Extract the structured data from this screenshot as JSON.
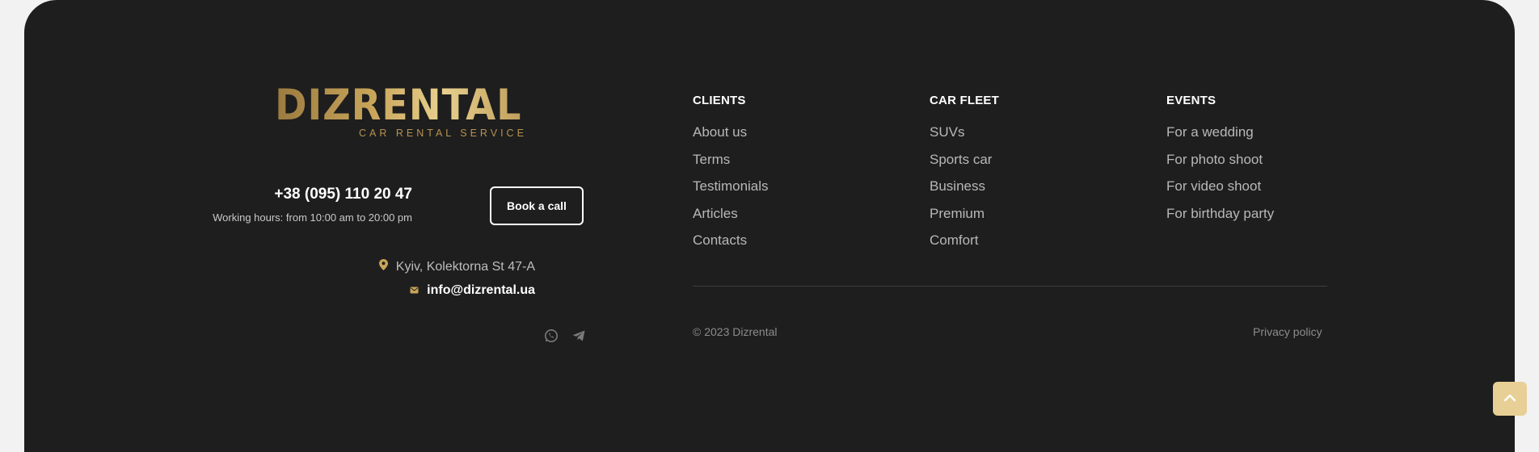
{
  "logo": {
    "word": "DIZRENTAL",
    "tagline": "CAR RENTAL SERVICE"
  },
  "contact": {
    "phone": "+38 (095) 110 20 47",
    "hours": "Working hours: from 10:00 am to 20:00 pm",
    "book_label": "Book a call",
    "address": "Kyiv, Kolektorna St 47-A",
    "email": "info@dizrental.ua",
    "address_icon": "map-pin-icon",
    "email_icon": "envelope-icon"
  },
  "socials": [
    {
      "icon": "whatsapp-icon"
    },
    {
      "icon": "telegram-icon"
    }
  ],
  "columns": [
    {
      "title": "CLIENTS",
      "links": [
        "About us",
        "Terms",
        "Testimonials",
        "Articles",
        "Contacts"
      ]
    },
    {
      "title": "CAR FLEET",
      "links": [
        "SUVs",
        "Sports car",
        "Business",
        "Premium",
        "Comfort"
      ]
    },
    {
      "title": "EVENTS",
      "links": [
        "For a wedding",
        "For photo shoot",
        "For video shoot",
        "For birthday party"
      ]
    }
  ],
  "bottom": {
    "copyright": "© 2023 Dizrental",
    "privacy": "Privacy policy"
  },
  "scroll_top_icon": "chevron-up-icon",
  "colors": {
    "background": "#1e1e1e",
    "page": "#f2f2f2",
    "gold": "#c9a55a",
    "scroll_button": "#e8cf95"
  }
}
